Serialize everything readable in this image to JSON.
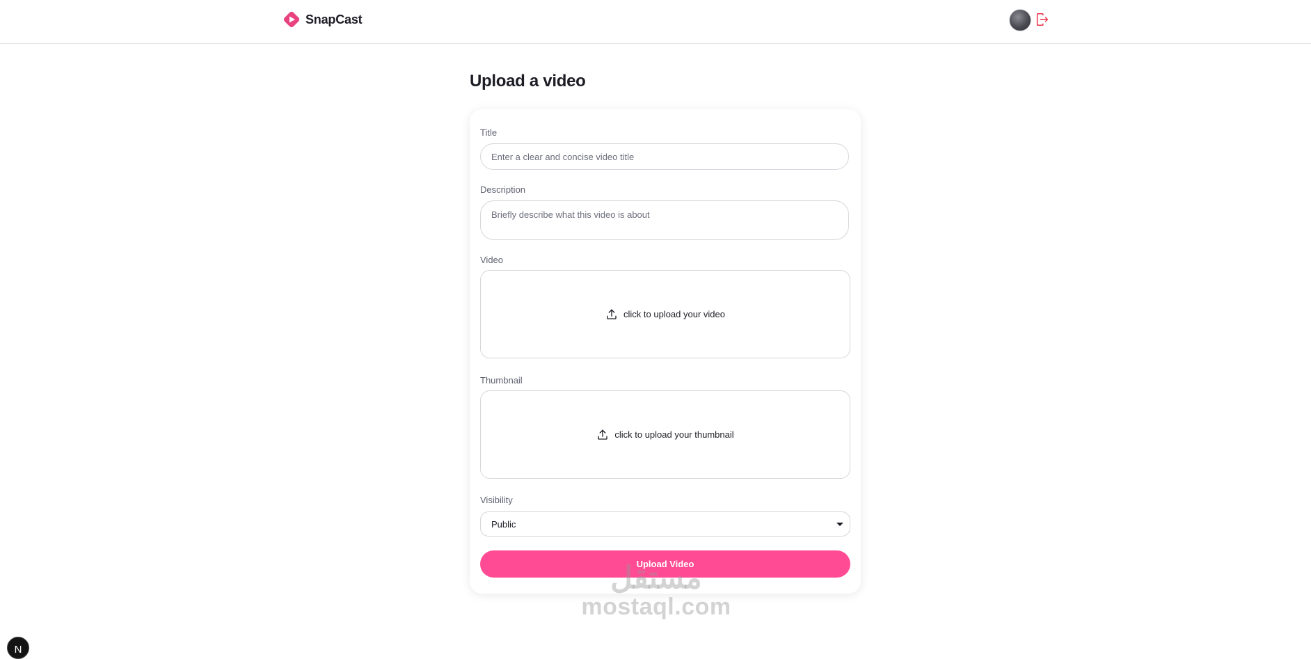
{
  "header": {
    "brand_name": "SnapCast",
    "brand_color": "#e8437f",
    "avatar_alt": "user avatar",
    "logout_icon": "logout-icon"
  },
  "page": {
    "title": "Upload a video"
  },
  "form": {
    "title_label": "Title",
    "title_placeholder": "Enter a clear and concise video title",
    "title_value": "",
    "description_label": "Description",
    "description_placeholder": "Briefly describe what this video is about",
    "description_value": "",
    "video_label": "Video",
    "video_dropzone_text": "click to upload your video",
    "thumbnail_label": "Thumbnail",
    "thumbnail_dropzone_text": "click to upload your thumbnail",
    "visibility_label": "Visibility",
    "visibility_value": "Public",
    "submit_label": "Upload Video",
    "accent_color": "#ff4b94"
  },
  "watermark": {
    "arabic": "مستقل",
    "latin": "mostaql.com"
  },
  "dev_badge": {
    "letter": "N"
  }
}
